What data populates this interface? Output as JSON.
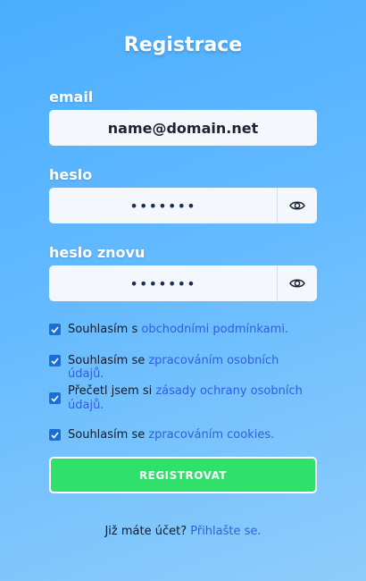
{
  "form": {
    "title": "Registrace",
    "email": {
      "label": "email",
      "value": "name@domain.net"
    },
    "password": {
      "label": "heslo",
      "value": "•••••••"
    },
    "password_again": {
      "label": "heslo znovu",
      "value": "•••••••"
    },
    "consents": [
      {
        "text": "Souhlasím s ",
        "link": "obchodními podmínkami.",
        "checked": true
      },
      {
        "text": "Souhlasím se ",
        "link": "zpracováním osobních údajů.",
        "checked": true
      },
      {
        "text": "Přečetl jsem si ",
        "link": "zásady ochrany osobních údajů.",
        "checked": true
      },
      {
        "text": "Souhlasím se ",
        "link": "zpracováním cookies.",
        "checked": true
      }
    ],
    "submit_label": "REGISTROVAT",
    "login_prompt": "Již máte účet? ",
    "login_link": "Přihlašte se."
  },
  "icons": {
    "password_toggle": "eye-icon",
    "checkbox": "checkmark-icon"
  },
  "colors": {
    "accent": "#2fe16b",
    "link": "#2f5fe0",
    "checkbox": "#1a6fd6"
  }
}
